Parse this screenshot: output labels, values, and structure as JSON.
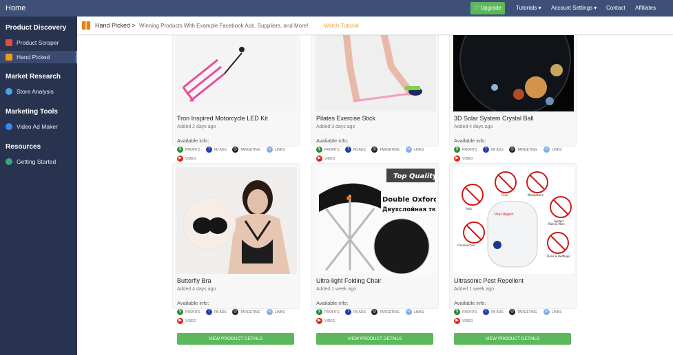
{
  "topbar": {
    "home": "Home",
    "upgrade": "♡ Upgrade",
    "tutorials": "Tutorials ▾",
    "account": "Account Settings ▾",
    "contact": "Contact",
    "affiliates": "Affiliates"
  },
  "sidebar": {
    "sections": [
      {
        "title": "Product Discovery",
        "items": [
          "Product Scraper",
          "Hand Picked"
        ]
      },
      {
        "title": "Market Research",
        "items": [
          "Store Analysis"
        ]
      },
      {
        "title": "Marketing Tools",
        "items": [
          "Video Ad Maker"
        ]
      },
      {
        "title": "Resources",
        "items": [
          "Getting Started"
        ]
      }
    ]
  },
  "breadcrumb": {
    "current": "Hand Picked >",
    "subtitle": "Winning Products With Example Facebook Ads, Suppliers, and More!",
    "tutorial": "Watch Tutorial"
  },
  "labels": {
    "available": "Available info:",
    "profits": "PROFITS",
    "fbads": "FB ADS",
    "targeting": "TARGETING",
    "links": "LINKS",
    "video": "VIDEO",
    "button": "VIEW PRODUCT DETAILS"
  },
  "products": [
    {
      "title": "Tron Inspired Motorcycle LED Kit",
      "added": "Added 2 days ago"
    },
    {
      "title": "Pilates Exercise Stick",
      "added": "Added 3 days ago"
    },
    {
      "title": "3D Solar System Crystal Ball",
      "added": "Added 4 days ago"
    },
    {
      "title": "Butterfly Bra",
      "added": "Added 4 days ago"
    },
    {
      "title": "Ultra-light Folding Chair",
      "added": "Added 1 week ago",
      "img_text": {
        "badge": "Top Quality",
        "line1": "Double Oxford Cloth",
        "line2": "Двухслойная ткань"
      }
    },
    {
      "title": "Ultrasonic Pest Repellent",
      "added": "Added 1 week ago",
      "img_text": {
        "l1": "Ants",
        "l2": "Flies",
        "l3": "Mosquitoes",
        "l4": "Spiders",
        "l5": "Rats & Mice",
        "l6": "Cockroaches",
        "l7": "Fleas & Bedbugs",
        "brand": "Pest Reject"
      }
    }
  ]
}
